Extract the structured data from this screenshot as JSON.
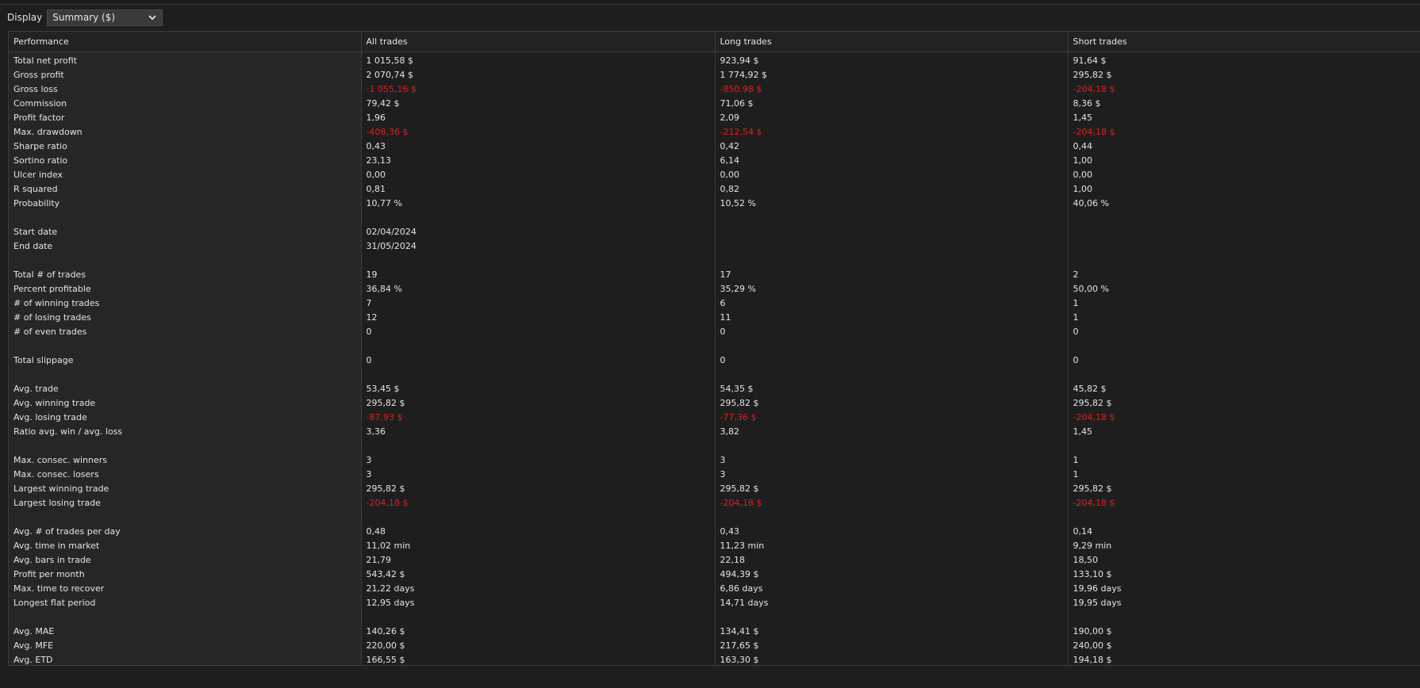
{
  "toolbar": {
    "display_label": "Display",
    "display_value": "Summary ($)",
    "dropdown_icon": "chevron-down-icon"
  },
  "table": {
    "headers": [
      "Performance",
      "All trades",
      "Long trades",
      "Short trades"
    ],
    "rows": [
      {
        "label": "Total net profit",
        "values": [
          "1 015,58 $",
          "923,94 $",
          "91,64 $"
        ],
        "negative": [
          false,
          false,
          false
        ]
      },
      {
        "label": "Gross profit",
        "values": [
          "2 070,74 $",
          "1 774,92 $",
          "295,82 $"
        ],
        "negative": [
          false,
          false,
          false
        ]
      },
      {
        "label": "Gross loss",
        "values": [
          "-1 055,16 $",
          "-850,98 $",
          "-204,18 $"
        ],
        "negative": [
          true,
          true,
          true
        ]
      },
      {
        "label": "Commission",
        "values": [
          "79,42 $",
          "71,06 $",
          "8,36 $"
        ],
        "negative": [
          false,
          false,
          false
        ]
      },
      {
        "label": "Profit factor",
        "values": [
          "1,96",
          "2,09",
          "1,45"
        ],
        "negative": [
          false,
          false,
          false
        ]
      },
      {
        "label": "Max. drawdown",
        "values": [
          "-408,36 $",
          "-212,54 $",
          "-204,18 $"
        ],
        "negative": [
          true,
          true,
          true
        ]
      },
      {
        "label": "Sharpe ratio",
        "values": [
          "0,43",
          "0,42",
          "0,44"
        ],
        "negative": [
          false,
          false,
          false
        ]
      },
      {
        "label": "Sortino ratio",
        "values": [
          "23,13",
          "6,14",
          "1,00"
        ],
        "negative": [
          false,
          false,
          false
        ]
      },
      {
        "label": "Ulcer index",
        "values": [
          "0,00",
          "0,00",
          "0,00"
        ],
        "negative": [
          false,
          false,
          false
        ]
      },
      {
        "label": "R squared",
        "values": [
          "0,81",
          "0,82",
          "1,00"
        ],
        "negative": [
          false,
          false,
          false
        ]
      },
      {
        "label": "Probability",
        "values": [
          "10,77 %",
          "10,52 %",
          "40,06 %"
        ],
        "negative": [
          false,
          false,
          false
        ]
      },
      {
        "label": "",
        "values": [
          "",
          "",
          ""
        ],
        "negative": [
          false,
          false,
          false
        ]
      },
      {
        "label": "Start date",
        "values": [
          "02/04/2024",
          "",
          ""
        ],
        "negative": [
          false,
          false,
          false
        ]
      },
      {
        "label": "End date",
        "values": [
          "31/05/2024",
          "",
          ""
        ],
        "negative": [
          false,
          false,
          false
        ]
      },
      {
        "label": "",
        "values": [
          "",
          "",
          ""
        ],
        "negative": [
          false,
          false,
          false
        ]
      },
      {
        "label": "Total # of trades",
        "values": [
          "19",
          "17",
          "2"
        ],
        "negative": [
          false,
          false,
          false
        ]
      },
      {
        "label": "Percent profitable",
        "values": [
          "36,84 %",
          "35,29 %",
          "50,00 %"
        ],
        "negative": [
          false,
          false,
          false
        ]
      },
      {
        "label": "# of winning trades",
        "values": [
          "7",
          "6",
          "1"
        ],
        "negative": [
          false,
          false,
          false
        ]
      },
      {
        "label": "# of losing trades",
        "values": [
          "12",
          "11",
          "1"
        ],
        "negative": [
          false,
          false,
          false
        ]
      },
      {
        "label": "# of even trades",
        "values": [
          "0",
          "0",
          "0"
        ],
        "negative": [
          false,
          false,
          false
        ]
      },
      {
        "label": "",
        "values": [
          "",
          "",
          ""
        ],
        "negative": [
          false,
          false,
          false
        ]
      },
      {
        "label": "Total slippage",
        "values": [
          "0",
          "0",
          "0"
        ],
        "negative": [
          false,
          false,
          false
        ]
      },
      {
        "label": "",
        "values": [
          "",
          "",
          ""
        ],
        "negative": [
          false,
          false,
          false
        ]
      },
      {
        "label": "Avg. trade",
        "values": [
          "53,45 $",
          "54,35 $",
          "45,82 $"
        ],
        "negative": [
          false,
          false,
          false
        ]
      },
      {
        "label": "Avg. winning trade",
        "values": [
          "295,82 $",
          "295,82 $",
          "295,82 $"
        ],
        "negative": [
          false,
          false,
          false
        ]
      },
      {
        "label": "Avg. losing trade",
        "values": [
          "-87,93 $",
          "-77,36 $",
          "-204,18 $"
        ],
        "negative": [
          true,
          true,
          true
        ]
      },
      {
        "label": "Ratio avg. win / avg. loss",
        "values": [
          "3,36",
          "3,82",
          "1,45"
        ],
        "negative": [
          false,
          false,
          false
        ]
      },
      {
        "label": "",
        "values": [
          "",
          "",
          ""
        ],
        "negative": [
          false,
          false,
          false
        ]
      },
      {
        "label": "Max. consec. winners",
        "values": [
          "3",
          "3",
          "1"
        ],
        "negative": [
          false,
          false,
          false
        ]
      },
      {
        "label": "Max. consec. losers",
        "values": [
          "3",
          "3",
          "1"
        ],
        "negative": [
          false,
          false,
          false
        ]
      },
      {
        "label": "Largest winning trade",
        "values": [
          "295,82 $",
          "295,82 $",
          "295,82 $"
        ],
        "negative": [
          false,
          false,
          false
        ]
      },
      {
        "label": "Largest losing trade",
        "values": [
          "-204,18 $",
          "-204,18 $",
          "-204,18 $"
        ],
        "negative": [
          true,
          true,
          true
        ]
      },
      {
        "label": "",
        "values": [
          "",
          "",
          ""
        ],
        "negative": [
          false,
          false,
          false
        ]
      },
      {
        "label": "Avg. # of trades per day",
        "values": [
          "0,48",
          "0,43",
          "0,14"
        ],
        "negative": [
          false,
          false,
          false
        ]
      },
      {
        "label": "Avg. time in market",
        "values": [
          "11,02 min",
          "11,23 min",
          "9,29 min"
        ],
        "negative": [
          false,
          false,
          false
        ]
      },
      {
        "label": "Avg. bars in trade",
        "values": [
          "21,79",
          "22,18",
          "18,50"
        ],
        "negative": [
          false,
          false,
          false
        ]
      },
      {
        "label": "Profit per month",
        "values": [
          "543,42 $",
          "494,39 $",
          "133,10 $"
        ],
        "negative": [
          false,
          false,
          false
        ]
      },
      {
        "label": "Max. time to recover",
        "values": [
          "21,22 days",
          "6,86 days",
          "19,96 days"
        ],
        "negative": [
          false,
          false,
          false
        ]
      },
      {
        "label": "Longest flat period",
        "values": [
          "12,95 days",
          "14,71 days",
          "19,95 days"
        ],
        "negative": [
          false,
          false,
          false
        ]
      },
      {
        "label": "",
        "values": [
          "",
          "",
          ""
        ],
        "negative": [
          false,
          false,
          false
        ]
      },
      {
        "label": "Avg. MAE",
        "values": [
          "140,26 $",
          "134,41 $",
          "190,00 $"
        ],
        "negative": [
          false,
          false,
          false
        ]
      },
      {
        "label": "Avg. MFE",
        "values": [
          "220,00 $",
          "217,65 $",
          "240,00 $"
        ],
        "negative": [
          false,
          false,
          false
        ]
      },
      {
        "label": "Avg. ETD",
        "values": [
          "166,55 $",
          "163,30 $",
          "194,18 $"
        ],
        "negative": [
          false,
          false,
          false
        ]
      }
    ]
  },
  "colors": {
    "background": "#1e1e1e",
    "label_column": "#262626",
    "negative": "#e01f1f",
    "text": "#e4e4e4",
    "grid_line": "#3c3c3c"
  }
}
